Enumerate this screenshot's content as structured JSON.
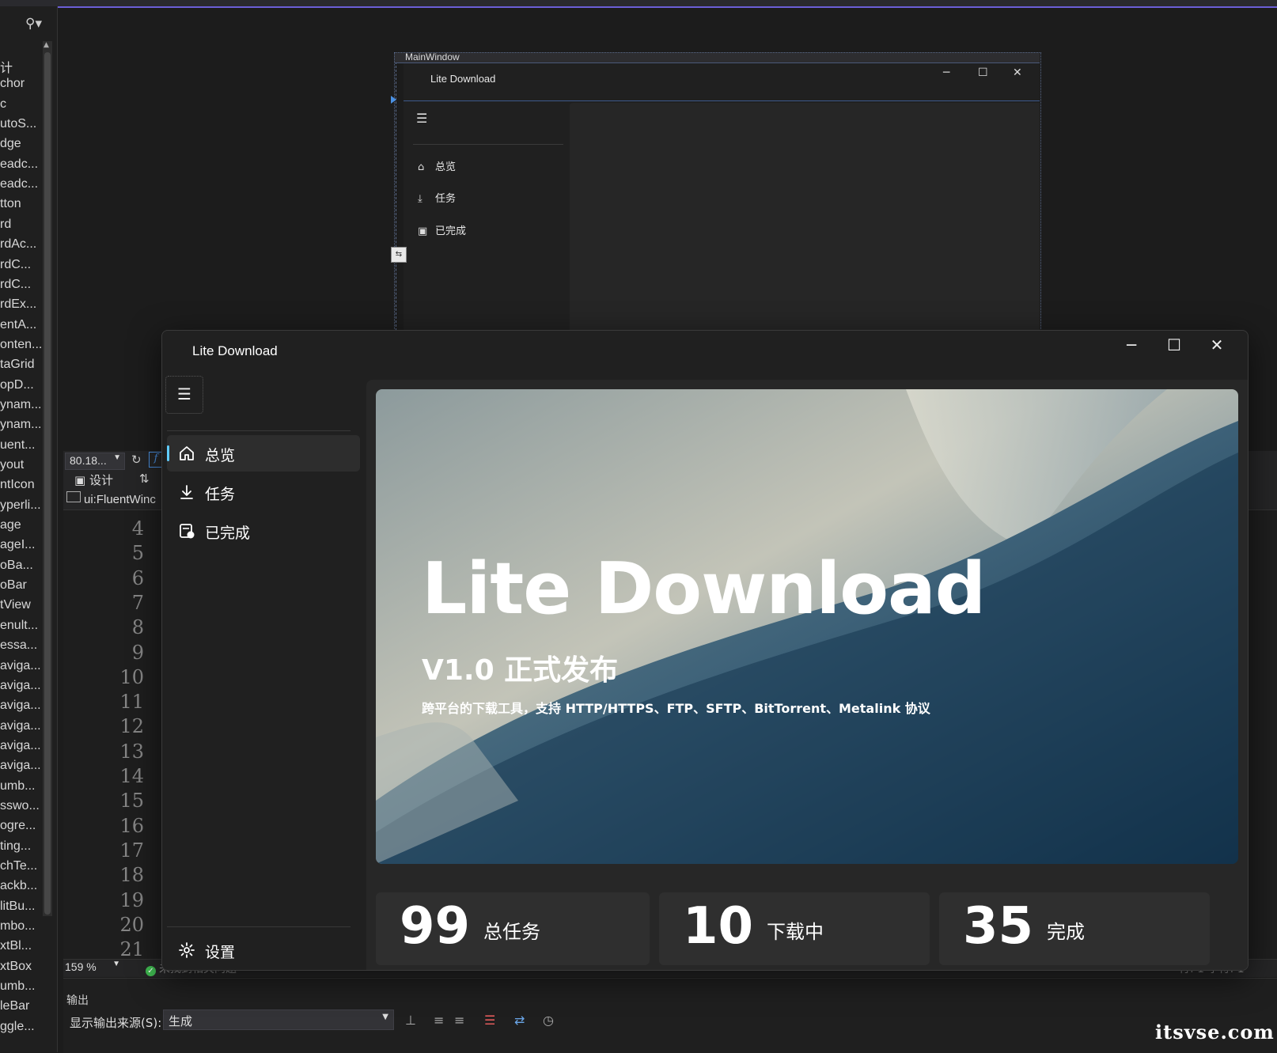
{
  "toolbox": {
    "search_icon": "search-icon",
    "items": [
      "计",
      "chor",
      "c",
      "utoS...",
      "dge",
      "eadc...",
      "eadc...",
      "tton",
      "rd",
      "rdAc...",
      "rdC...",
      "rdC...",
      "rdEx...",
      "entA...",
      "onten...",
      "taGrid",
      "opD...",
      "ynam...",
      "ynam...",
      "uent...",
      "yout",
      "ntIcon",
      "yperli...",
      "age",
      "ageI...",
      "oBa...",
      "oBar",
      "tView",
      "enult...",
      "essa...",
      "aviga...",
      "aviga...",
      "aviga...",
      "aviga...",
      "aviga...",
      "aviga...",
      "umb...",
      "sswo...",
      "ogre...",
      "ting...",
      "chTe...",
      "ackb...",
      "litBu...",
      "mbo...",
      "xtBl...",
      "xtBox",
      "umb...",
      "leBar",
      "ggle..."
    ]
  },
  "designer": {
    "main_window_label": "MainWindow",
    "inner_title": "Lite Download",
    "nav": [
      {
        "icon": "home-icon",
        "label": "总览"
      },
      {
        "icon": "download-icon",
        "label": "任务"
      },
      {
        "icon": "completed-icon",
        "label": "已完成"
      }
    ]
  },
  "editor": {
    "zoom_top": "80.18...",
    "design_tab": "设计",
    "breadcrumb": "ui:FluentWinc",
    "line_numbers": [
      "4",
      "5",
      "6",
      "7",
      "8",
      "9",
      "10",
      "11",
      "12",
      "13",
      "14",
      "15",
      "16",
      "17",
      "18",
      "19",
      "20",
      "21"
    ],
    "zoom_bottom": "159 %",
    "status": "未找到相关问题",
    "position": "行: 1    字符: 1"
  },
  "output": {
    "title": "输出",
    "source_label": "显示输出来源(S):",
    "source_value": "生成"
  },
  "watermark": "itsvse.com",
  "app": {
    "title": "Lite Download",
    "nav": [
      {
        "icon": "home-icon",
        "label": "总览",
        "selected": true
      },
      {
        "icon": "download-icon",
        "label": "任务",
        "selected": false
      },
      {
        "icon": "completed-icon",
        "label": "已完成",
        "selected": false
      }
    ],
    "settings_label": "设置",
    "hero": {
      "title": "Lite Download",
      "subtitle": "V1.0 正式发布",
      "description": "跨平台的下载工具，支持 HTTP/HTTPS、FTP、SFTP、BitTorrent、Metalink 协议"
    },
    "stats": [
      {
        "value": "99",
        "label": "总任务"
      },
      {
        "value": "10",
        "label": "下载中"
      },
      {
        "value": "35",
        "label": "完成"
      }
    ],
    "accent_color": "#60cdff"
  }
}
